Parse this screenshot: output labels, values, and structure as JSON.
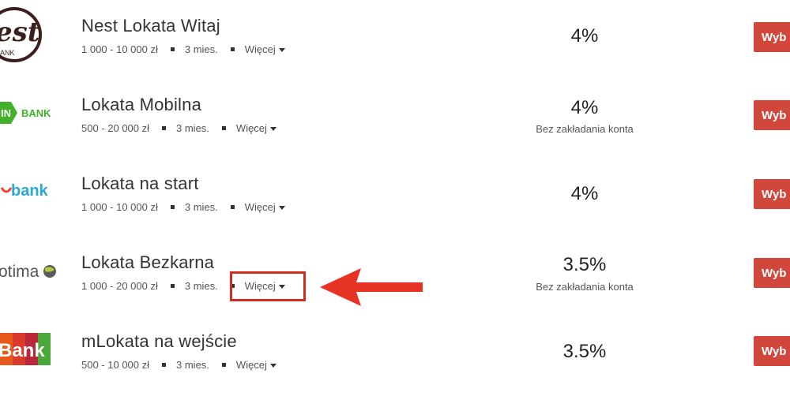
{
  "offers": [
    {
      "logo": {
        "text": "est",
        "subtext": "ANK",
        "icon": "nest-bank-logo-icon"
      },
      "title": "Nest Lokata Witaj",
      "amount": "1 000 - 10 000 zł",
      "term": "3 mies.",
      "more_label": "Więcej",
      "rate": "4%",
      "note": "",
      "button_label": "Wyb"
    },
    {
      "logo": {
        "text": "IN",
        "subtext": "BANK",
        "icon": "inbank-logo-icon"
      },
      "title": "Lokata Mobilna",
      "amount": "500 - 20 000 zł",
      "term": "3 mies.",
      "more_label": "Więcej",
      "rate": "4%",
      "note": "Bez zakładania konta",
      "button_label": "Wyb"
    },
    {
      "logo": {
        "text": "bank",
        "subtext": "",
        "icon": "bank-logo-icon"
      },
      "title": "Lokata na start",
      "amount": "1 000 - 10 000 zł",
      "term": "3 mies.",
      "more_label": "Więcej",
      "rate": "4%",
      "note": "",
      "button_label": "Wyb"
    },
    {
      "logo": {
        "text": "otima",
        "subtext": "",
        "icon": "optima-logo-icon"
      },
      "title": "Lokata Bezkarna",
      "amount": "1 000 - 20 000 zł",
      "term": "3 mies.",
      "more_label": "Więcej",
      "rate": "3.5%",
      "note": "Bez zakładania konta",
      "button_label": "Wyb"
    },
    {
      "logo": {
        "text": "Bank",
        "subtext": "",
        "icon": "mbank-logo-icon"
      },
      "title": "mLokata na wejście",
      "amount": "500 - 10 000 zł",
      "term": "3 mies.",
      "more_label": "Więcej",
      "rate": "3.5%",
      "note": "",
      "button_label": "Wyb"
    }
  ],
  "annotation": {
    "color": "#d22c1f",
    "target": "Więcej"
  },
  "colors": {
    "button": "#d2473b",
    "text": "#333333"
  }
}
